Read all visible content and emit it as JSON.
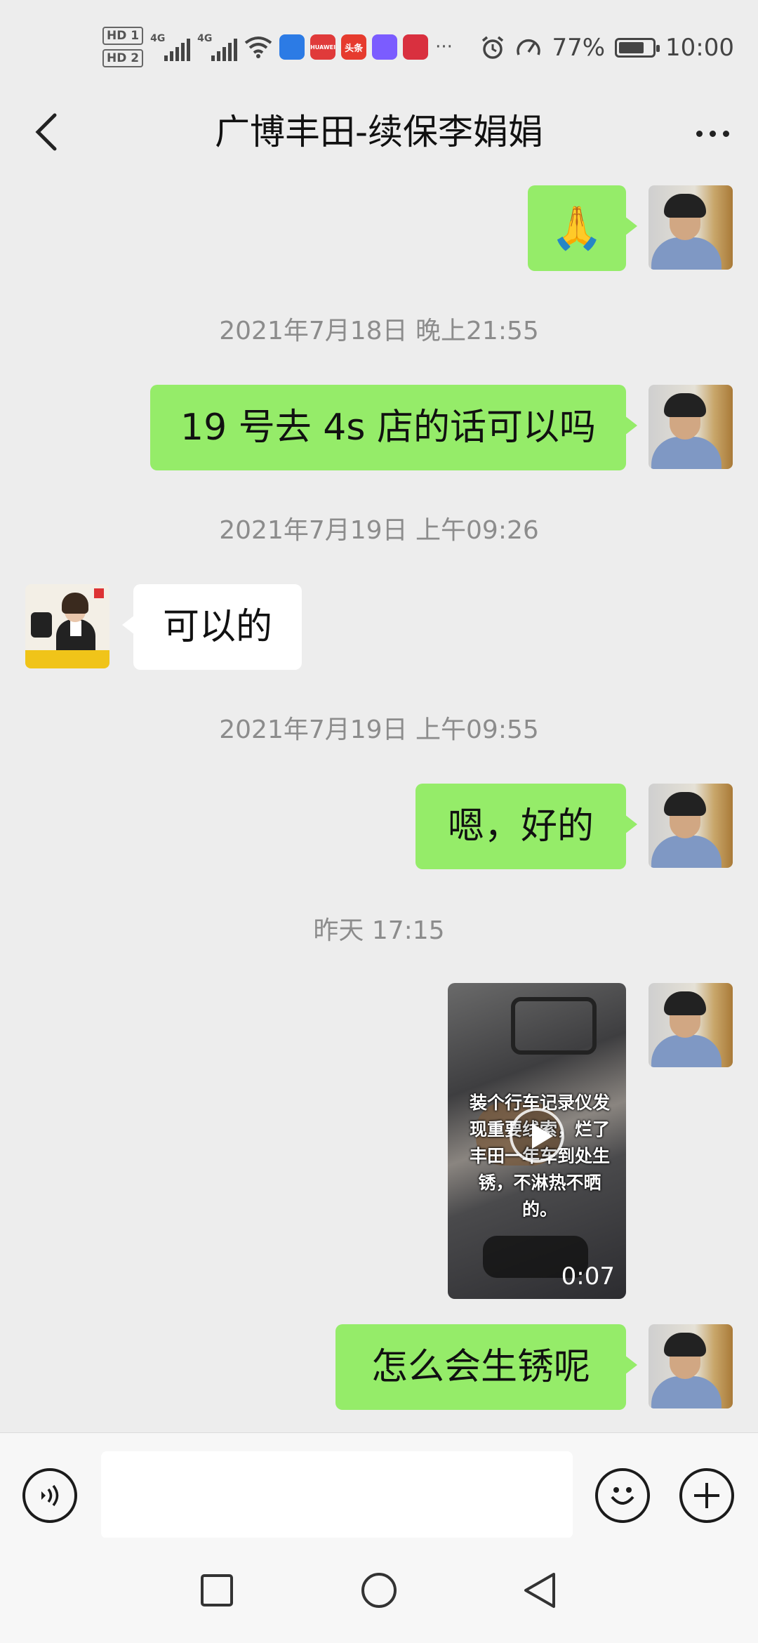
{
  "status_bar": {
    "hd1": "HD 1",
    "hd2": "HD 2",
    "network1": "4G",
    "network2": "4G",
    "app_icons": [
      {
        "name": "baidu-map-icon",
        "text": "",
        "color": "#2c7be5"
      },
      {
        "name": "huawei-icon",
        "text": "HUAWEI",
        "color": "#e03a3a"
      },
      {
        "name": "toutiao-icon",
        "text": "头条",
        "color": "#e63b2e"
      },
      {
        "name": "app-colorful-icon",
        "text": "",
        "color": "#7b5cff"
      },
      {
        "name": "book-icon",
        "text": "",
        "color": "#d9303f"
      }
    ],
    "more": "···",
    "battery": "77%",
    "battery_level": 0.77,
    "time": "10:00"
  },
  "header": {
    "title": "广博丰田-续保李娟娟"
  },
  "messages": [
    {
      "type": "me",
      "text": "🙏"
    },
    {
      "type": "time",
      "text": "2021年7月18日 晚上21:55"
    },
    {
      "type": "me",
      "text": "19 号去 4s 店的话可以吗"
    },
    {
      "type": "time",
      "text": "2021年7月19日 上午09:26"
    },
    {
      "type": "other",
      "text": "可以的"
    },
    {
      "type": "time",
      "text": "2021年7月19日 上午09:55"
    },
    {
      "type": "me",
      "text": "嗯，好的"
    },
    {
      "type": "time",
      "text": "昨天 17:15"
    },
    {
      "type": "video",
      "caption": "装个行车记录仪发现重要线索，烂了丰田一年车到处生锈，不淋热不晒的。",
      "duration": "0:07"
    },
    {
      "type": "me",
      "text": "怎么会生锈呢"
    }
  ],
  "input": {
    "placeholder": "",
    "value": ""
  }
}
